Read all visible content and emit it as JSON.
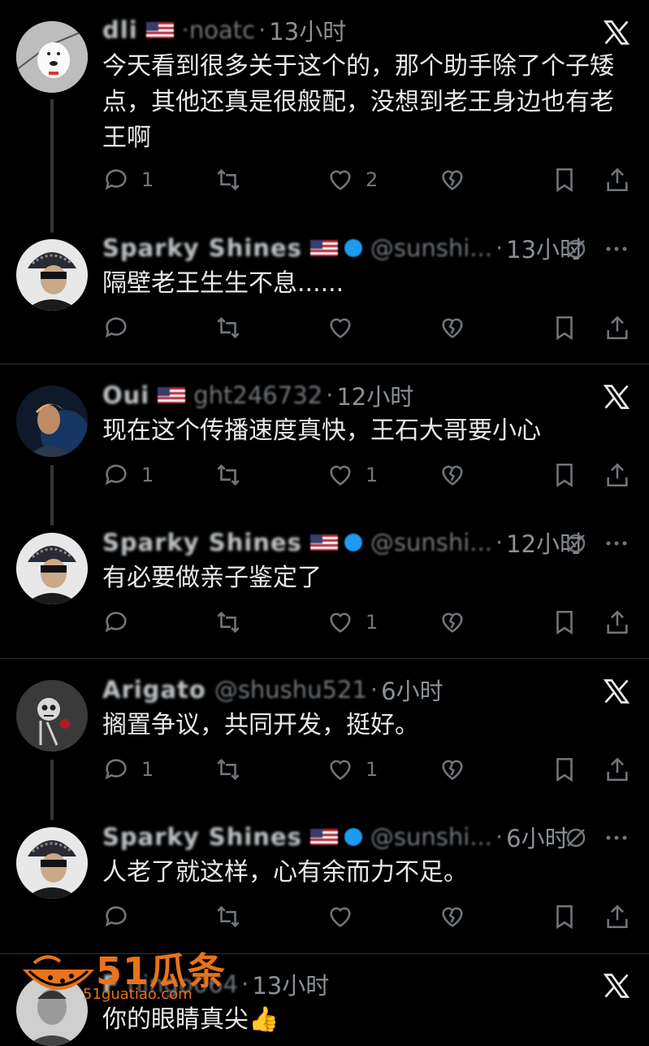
{
  "tweets": [
    {
      "name": "dli",
      "handle": "·noatc",
      "time": "13小时",
      "text": "今天看到很多关于这个的，那个助手除了个子矮点，其他还真是很般配，没想到老王身边也有老王啊",
      "reply": "1",
      "retweet": "",
      "like": "2",
      "avatar": "poodle-avatar",
      "right": "x-logo"
    },
    {
      "name": "Sparky Shines",
      "handle": "@sunshi...",
      "time": "13小时",
      "text": "隔壁老王生生不息......",
      "reply": "",
      "retweet": "",
      "like": "",
      "avatar": "cap-woman-avatar",
      "right": "grok-icon"
    },
    {
      "name": "Oui",
      "handle": "ght246732",
      "time": "12小时",
      "text": "现在这个传播速度真快，王石大哥要小心",
      "reply": "1",
      "retweet": "",
      "like": "1",
      "avatar": "dark-portrait-avatar",
      "right": "x-logo"
    },
    {
      "name": "Sparky Shines",
      "handle": "@sunshi...",
      "time": "12小时",
      "text": "有必要做亲子鉴定了",
      "reply": "",
      "retweet": "",
      "like": "1",
      "avatar": "cap-woman-avatar",
      "right": "grok-icon"
    },
    {
      "name": "Arigato",
      "handle": "@shushu521",
      "time": "6小时",
      "text": "搁置争议，共同开发，挺好。",
      "reply": "1",
      "retweet": "",
      "like": "1",
      "avatar": "skull-avatar",
      "right": "x-logo"
    },
    {
      "name": "Sparky Shines",
      "handle": "@sunshi...",
      "time": "6小时",
      "text": "人老了就这样，心有余而力不足。",
      "reply": "",
      "retweet": "",
      "like": "",
      "avatar": "cap-woman-avatar",
      "right": "grok-icon"
    },
    {
      "name": "F",
      "handle": "ningo064",
      "time": "13小时",
      "text": "你的眼睛真尖👍",
      "reply": "",
      "retweet": "",
      "like": "",
      "avatar": "man-avatar",
      "right": "x-logo"
    }
  ],
  "watermark": {
    "brand": "51瓜条",
    "url": "51guatiao.com"
  },
  "colors": {
    "background": "#000000",
    "text": "#e7e9ea",
    "muted": "#71767b",
    "divider": "#2f3336"
  }
}
